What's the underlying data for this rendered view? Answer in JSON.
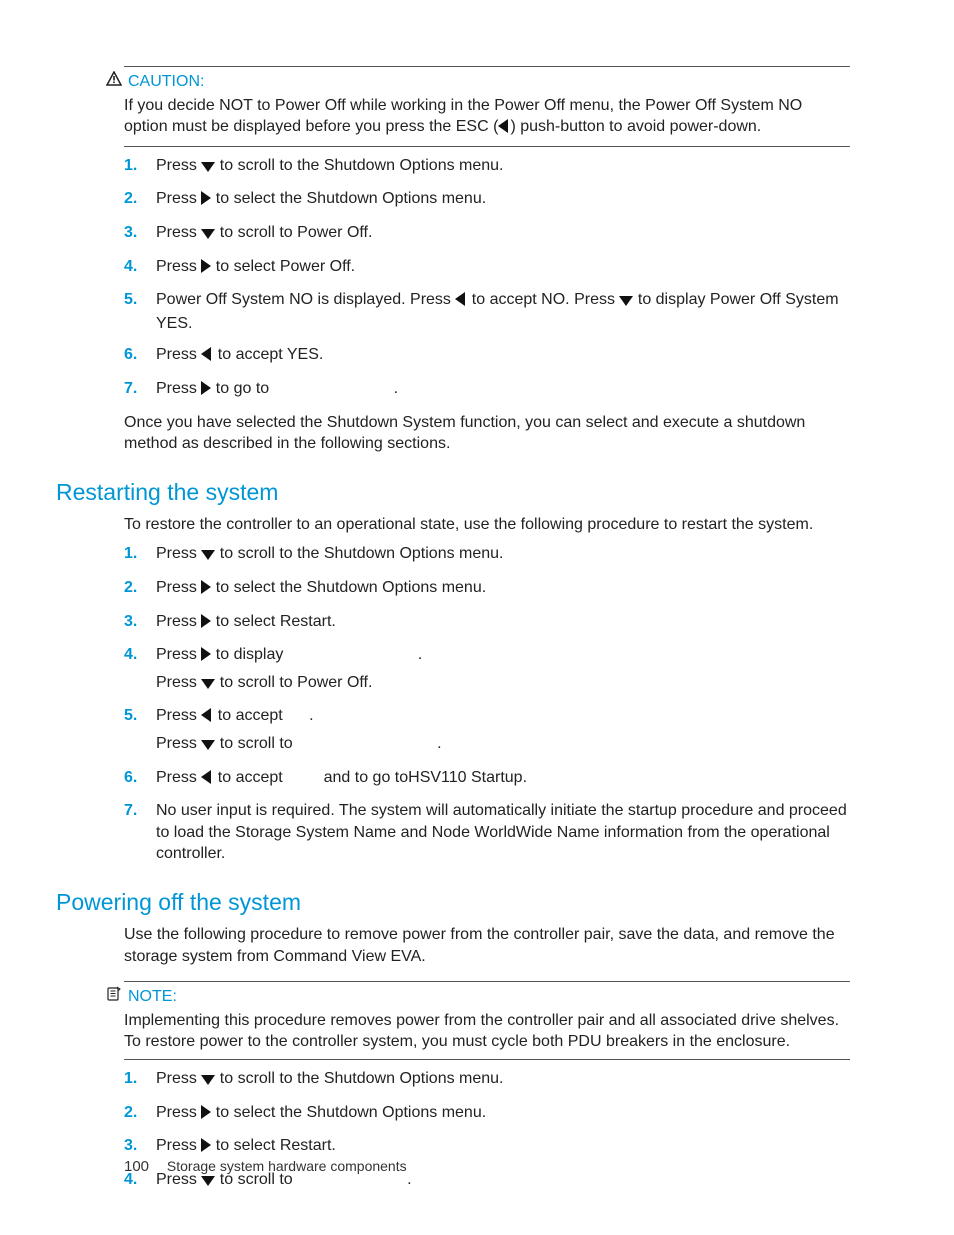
{
  "caution": {
    "title": "CAUTION:",
    "body": "If you decide NOT to Power Off while working in the Power Off menu, the Power Off System NO option must be displayed before you press the ESC (",
    "body_tail": ") push-button to avoid power-down."
  },
  "steps_a": {
    "s1": {
      "a": "Press ",
      "b": " to scroll to the Shutdown Options menu."
    },
    "s2": {
      "a": "Press ",
      "b": " to select the Shutdown Options menu."
    },
    "s3": {
      "a": "Press ",
      "b": " to scroll to Power Off."
    },
    "s4": {
      "a": "Press ",
      "b": " to select Power Off."
    },
    "s5": {
      "a": "Power Off System NO is displayed.  Press ",
      "b": " to accept NO. Press ",
      "c": " to display Power Off System YES."
    },
    "s6": {
      "a": "Press ",
      "b": " to accept YES."
    },
    "s7": {
      "a": "Press ",
      "b": " to go to ",
      "c": "."
    }
  },
  "para_a": "Once you have selected the Shutdown System function, you can select and execute a shutdown method as described in the following sections.",
  "heading_restart": "Restarting the system",
  "para_restart": "To restore the controller to an operational state, use the following procedure to restart the system.",
  "steps_b": {
    "s1": {
      "a": "Press ",
      "b": " to scroll to the Shutdown Options menu."
    },
    "s2": {
      "a": "Press ",
      "b": " to select the Shutdown Options menu."
    },
    "s3": {
      "a": "Press ",
      "b": " to select Restart."
    },
    "s4": {
      "a": "Press ",
      "b": " to display ",
      "c": ".",
      "sub_a": "Press ",
      "sub_b": " to scroll to Power Off."
    },
    "s5": {
      "a": "Press ",
      "b": " to accept ",
      "c": ".",
      "sub_a": "Press ",
      "sub_b": " to scroll to ",
      "sub_c": "."
    },
    "s6": {
      "a": "Press ",
      "b": " to accept ",
      "c": " and to go to",
      "d": "HSV110 Startup."
    },
    "s7": "No user input is required.  The system will automatically initiate the startup procedure and proceed to load the Storage System Name and Node WorldWide Name information from the operational controller."
  },
  "heading_poweroff": "Powering off the system",
  "para_poweroff": "Use the following procedure to remove power from the controller pair, save the data, and remove the storage system from Command View EVA.",
  "note": {
    "title": "NOTE:",
    "body": "Implementing this procedure removes power from the controller pair and all associated drive shelves. To restore power to the controller system, you must cycle both PDU breakers in the enclosure."
  },
  "steps_c": {
    "s1": {
      "a": "Press ",
      "b": " to scroll to the Shutdown Options menu."
    },
    "s2": {
      "a": "Press ",
      "b": " to select the Shutdown Options menu."
    },
    "s3": {
      "a": "Press ",
      "b": " to select Restart."
    },
    "s4": {
      "a": "Press ",
      "b": " to scroll to ",
      "c": "."
    }
  },
  "footer": {
    "page": "100",
    "title": "Storage system hardware components"
  }
}
